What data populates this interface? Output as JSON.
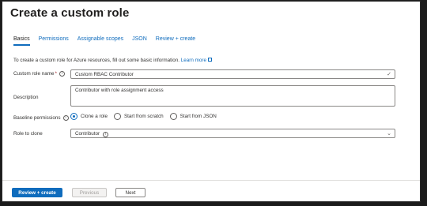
{
  "header": {
    "title": "Create a custom role",
    "more": "···"
  },
  "tabs": [
    {
      "label": "Basics",
      "active": true
    },
    {
      "label": "Permissions"
    },
    {
      "label": "Assignable scopes"
    },
    {
      "label": "JSON"
    },
    {
      "label": "Review + create"
    }
  ],
  "intro": {
    "text": "To create a custom role for Azure resources, fill out some basic information.",
    "link": "Learn more"
  },
  "form": {
    "name_label": "Custom role name",
    "name_required": "*",
    "name_value": "Custom RBAC Contributor",
    "description_label": "Description",
    "description_value": "Contributor with role assignment access",
    "baseline_label": "Baseline permissions",
    "baseline_options": [
      "Clone a role",
      "Start from scratch",
      "Start from JSON"
    ],
    "baseline_selected": "Clone a role",
    "clone_label": "Role to clone",
    "clone_value": "Contributor"
  },
  "footer": {
    "primary": "Review + create",
    "previous": "Previous",
    "next": "Next"
  },
  "colors": {
    "accent": "#0f6cbd",
    "required": "#a4262c"
  }
}
